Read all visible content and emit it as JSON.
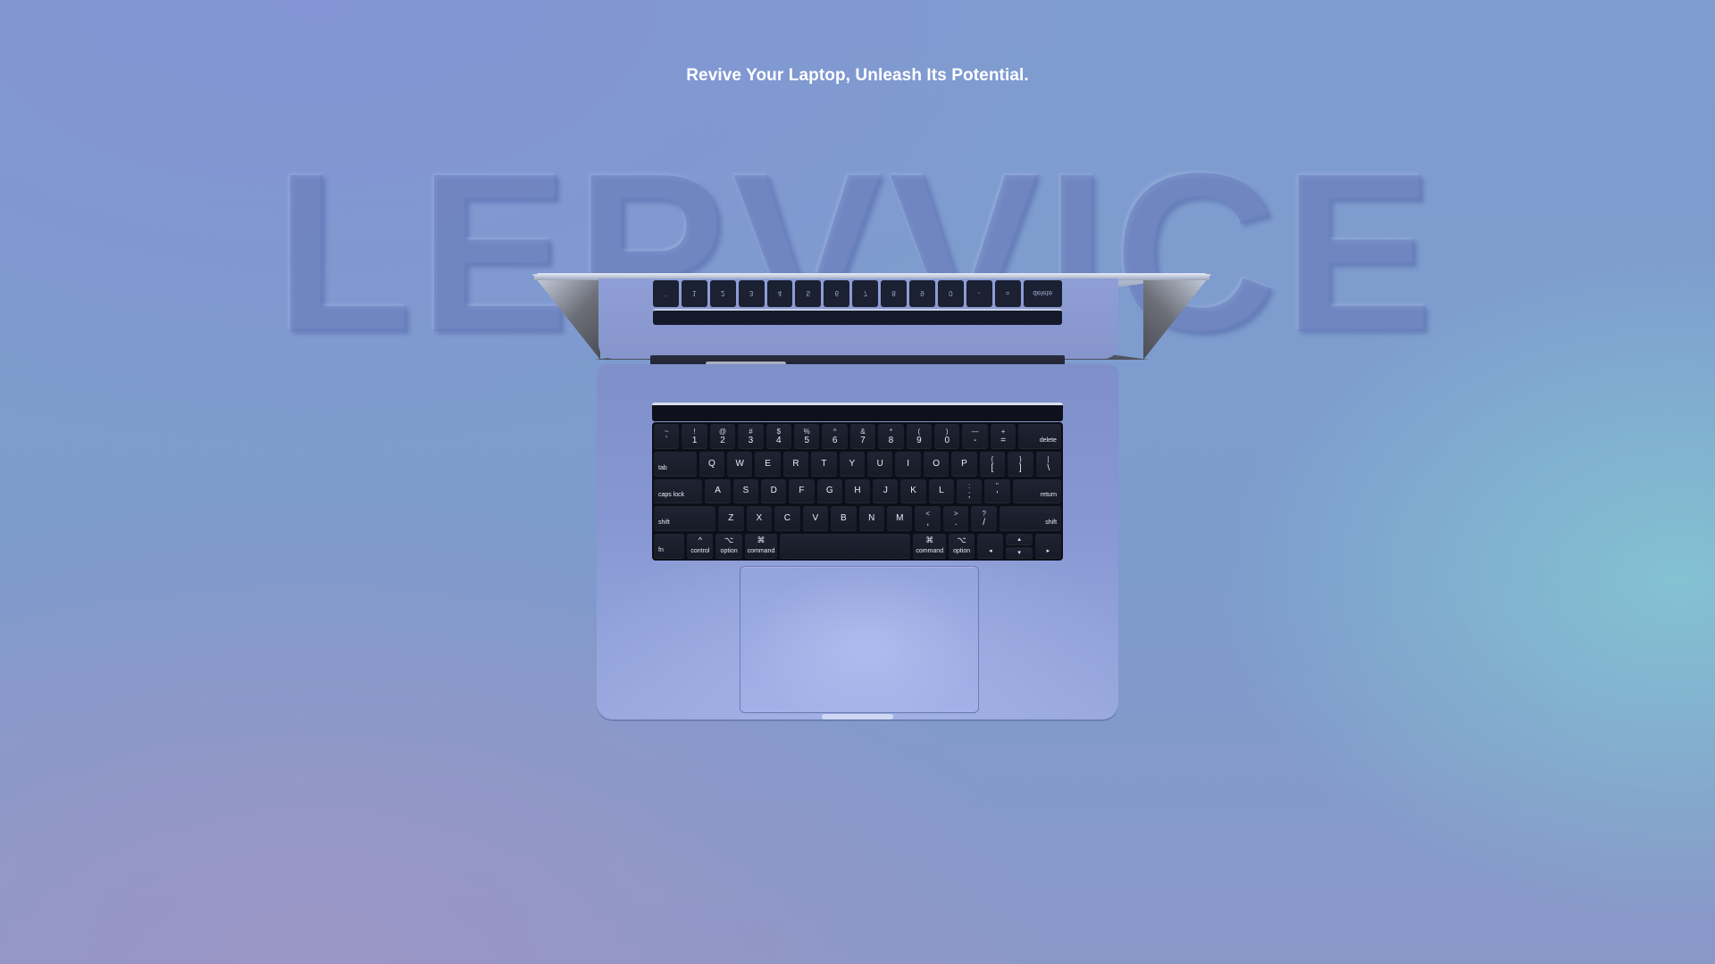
{
  "hero": {
    "tagline": "Revive Your Laptop, Unleash Its Potential.",
    "brand": "LEPVVICE"
  },
  "keyboard": {
    "rows": [
      [
        {
          "top": "~",
          "bottom": "`",
          "w": 1
        },
        {
          "top": "!",
          "bottom": "1",
          "w": 1
        },
        {
          "top": "@",
          "bottom": "2",
          "w": 1
        },
        {
          "top": "#",
          "bottom": "3",
          "w": 1
        },
        {
          "top": "$",
          "bottom": "4",
          "w": 1
        },
        {
          "top": "%",
          "bottom": "5",
          "w": 1
        },
        {
          "top": "^",
          "bottom": "6",
          "w": 1
        },
        {
          "top": "&",
          "bottom": "7",
          "w": 1
        },
        {
          "top": "*",
          "bottom": "8",
          "w": 1
        },
        {
          "top": "(",
          "bottom": "9",
          "w": 1
        },
        {
          "top": ")",
          "bottom": "0",
          "w": 1
        },
        {
          "top": "—",
          "bottom": "-",
          "w": 1
        },
        {
          "top": "+",
          "bottom": "=",
          "w": 1
        },
        {
          "label": "delete",
          "w": 1.5,
          "mod": "right"
        }
      ],
      [
        {
          "label": "tab",
          "w": 1.5,
          "mod": "left"
        },
        {
          "bottom": "Q",
          "w": 1
        },
        {
          "bottom": "W",
          "w": 1
        },
        {
          "bottom": "E",
          "w": 1
        },
        {
          "bottom": "R",
          "w": 1
        },
        {
          "bottom": "T",
          "w": 1
        },
        {
          "bottom": "Y",
          "w": 1
        },
        {
          "bottom": "U",
          "w": 1
        },
        {
          "bottom": "I",
          "w": 1
        },
        {
          "bottom": "O",
          "w": 1
        },
        {
          "bottom": "P",
          "w": 1
        },
        {
          "top": "{",
          "bottom": "[",
          "w": 1
        },
        {
          "top": "}",
          "bottom": "]",
          "w": 1
        },
        {
          "top": "|",
          "bottom": "\\",
          "w": 1
        }
      ],
      [
        {
          "label": "caps lock",
          "w": 1.75,
          "mod": "left"
        },
        {
          "bottom": "A",
          "w": 1
        },
        {
          "bottom": "S",
          "w": 1
        },
        {
          "bottom": "D",
          "w": 1
        },
        {
          "bottom": "F",
          "w": 1
        },
        {
          "bottom": "G",
          "w": 1
        },
        {
          "bottom": "H",
          "w": 1
        },
        {
          "bottom": "J",
          "w": 1
        },
        {
          "bottom": "K",
          "w": 1
        },
        {
          "bottom": "L",
          "w": 1
        },
        {
          "top": ":",
          "bottom": ";",
          "w": 1
        },
        {
          "top": "\"",
          "bottom": "'",
          "w": 1
        },
        {
          "label": "return",
          "w": 1.75,
          "mod": "right"
        }
      ],
      [
        {
          "label": "shift",
          "w": 2.25,
          "mod": "left"
        },
        {
          "bottom": "Z",
          "w": 1
        },
        {
          "bottom": "X",
          "w": 1
        },
        {
          "bottom": "C",
          "w": 1
        },
        {
          "bottom": "V",
          "w": 1
        },
        {
          "bottom": "B",
          "w": 1
        },
        {
          "bottom": "N",
          "w": 1
        },
        {
          "bottom": "M",
          "w": 1
        },
        {
          "top": "<",
          "bottom": ",",
          "w": 1
        },
        {
          "top": ">",
          "bottom": ".",
          "w": 1
        },
        {
          "top": "?",
          "bottom": "/",
          "w": 1
        },
        {
          "label": "shift",
          "w": 2.25,
          "mod": "right"
        }
      ],
      [
        {
          "label": "fn",
          "w": 1,
          "mod": "left"
        },
        {
          "label": "control",
          "sym": "^",
          "w": 1,
          "mod": "center"
        },
        {
          "label": "option",
          "sym": "⌥",
          "w": 1,
          "mod": "center"
        },
        {
          "label": "command",
          "sym": "⌘",
          "w": 1.25,
          "mod": "center"
        },
        {
          "label": "",
          "w": 5,
          "mod": "center"
        },
        {
          "label": "command",
          "sym": "⌘",
          "w": 1.25,
          "mod": "center"
        },
        {
          "label": "option",
          "sym": "⌥",
          "w": 1,
          "mod": "center"
        },
        {
          "label": "◂",
          "w": 1,
          "mod": "center"
        },
        {
          "arrows": [
            "▴",
            "▾"
          ],
          "w": 1
        },
        {
          "label": "▸",
          "w": 1,
          "mod": "center"
        }
      ]
    ]
  }
}
